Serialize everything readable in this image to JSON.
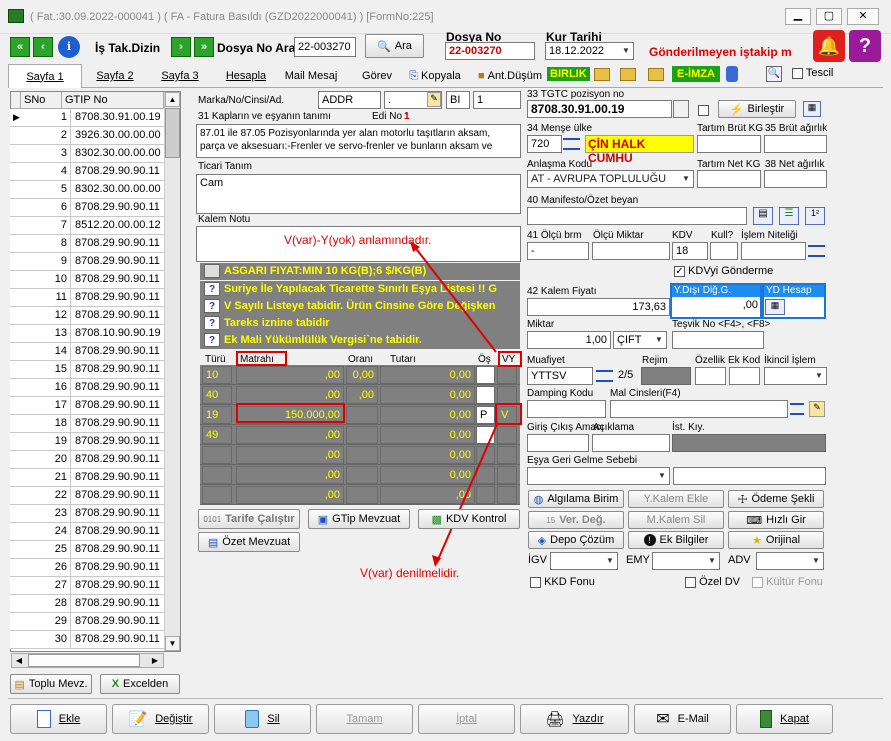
{
  "window": {
    "title": "( Fat.:30.09.2022-000041 ) ( FA  - Fatura Basıldı (GZD2022000041) ) [FormNo:225]"
  },
  "toolbar": {
    "is_takip": "İş Tak.Dizin",
    "dosya_no_ara": "Dosya No Ara",
    "dosya_no_value": "22-003270",
    "ara": "Ara",
    "dosya_no_label": "Dosya No",
    "dosya_no_red": "22-003270",
    "kur_tarihi_label": "Kur Tarihi",
    "kur_tarihi": "18.12.2022",
    "gonderilmeyen": "Gönderilmeyen iştakip m"
  },
  "tabs": [
    "Sayfa 1",
    "Sayfa 2",
    "Sayfa 3",
    "Hesapla",
    "Mail Mesaj",
    "Görev",
    "Kopyala",
    "Ant.Düşüm"
  ],
  "tab_extras": {
    "birlik": "BIRLIK",
    "eimza": "E-İMZA",
    "tescil": "Tescil"
  },
  "grid": {
    "col_sno": "SNo",
    "col_gtip": "GTIP No",
    "rows": [
      [
        "1",
        "8708.30.91.00.19"
      ],
      [
        "2",
        "3926.30.00.00.00"
      ],
      [
        "3",
        "8302.30.00.00.00"
      ],
      [
        "4",
        "8708.29.90.90.11"
      ],
      [
        "5",
        "8302.30.00.00.00"
      ],
      [
        "6",
        "8708.29.90.90.11"
      ],
      [
        "7",
        "8512.20.00.00.12"
      ],
      [
        "8",
        "8708.29.90.90.11"
      ],
      [
        "9",
        "8708.29.90.90.11"
      ],
      [
        "10",
        "8708.29.90.90.11"
      ],
      [
        "11",
        "8708.29.90.90.11"
      ],
      [
        "12",
        "8708.29.90.90.11"
      ],
      [
        "13",
        "8708.10.90.90.19"
      ],
      [
        "14",
        "8708.29.90.90.11"
      ],
      [
        "15",
        "8708.29.90.90.11"
      ],
      [
        "16",
        "8708.29.90.90.11"
      ],
      [
        "17",
        "8708.29.90.90.11"
      ],
      [
        "18",
        "8708.29.90.90.11"
      ],
      [
        "19",
        "8708.29.90.90.11"
      ],
      [
        "20",
        "8708.29.90.90.11"
      ],
      [
        "21",
        "8708.29.90.90.11"
      ],
      [
        "22",
        "8708.29.90.90.11"
      ],
      [
        "23",
        "8708.29.90.90.11"
      ],
      [
        "24",
        "8708.29.90.90.11"
      ],
      [
        "25",
        "8708.29.90.90.11"
      ],
      [
        "26",
        "8708.29.90.90.11"
      ],
      [
        "27",
        "8708.29.90.90.11"
      ],
      [
        "28",
        "8708.29.90.90.11"
      ],
      [
        "29",
        "8708.29.90.90.11"
      ],
      [
        "30",
        "8708.29.90.90.11"
      ]
    ]
  },
  "left_buttons": {
    "toplu": "Toplu Mevz.",
    "excel": "Excelden"
  },
  "form": {
    "marka_label": "Marka/No/Cinsi/Ad.",
    "marka_val": "ADDR",
    "marka_val2": ".",
    "marka_val3": "BI",
    "marka_val4": "1",
    "kap_label": "31 Kapların ve eşyanın tanımı",
    "edi_label": "Edi No :",
    "edi_val": "1",
    "tanim": "87.01 ile 87.05 Pozisyonlarında yer alan motorlu taşıtların aksam, parça ve aksesuarı:-Frenler ve servo-frenler ve bunların aksam ve",
    "ticari_label": "Ticari Tanım",
    "ticari_val": "Cam",
    "kalem_notu_label": "Kalem Notu",
    "annotation1": "V(var)-Y(yok) anlamındadır.",
    "annotation2": "V(var) denilmelidir."
  },
  "warnings": {
    "asgari": "ASGARI FIYAT:MIN 10 KG(B);6 $/KG(B)",
    "w1": "Suriye İle Yapılacak Ticarette Sınırlı Eşya Listesi !! G",
    "w2": "V Sayılı Listeye tabidir. Ürün Cinsine Göre Değişken",
    "w3": "Tareks iznine tabidir",
    "w4": "Ek Mali Yükümlülük Vergisi`ne tabidir."
  },
  "tax": {
    "h_turu": "Türü",
    "h_matrahi": "Matrahı",
    "h_orani": "Oranı",
    "h_tutari": "Tutarı",
    "h_os": "Öş",
    "h_vy": "VY",
    "rows": [
      {
        "turu": "10",
        "matrah": ",00",
        "oran": "0,00",
        "tutar": "0,00",
        "os": "",
        "vy": ""
      },
      {
        "turu": "40",
        "matrah": ",00",
        "oran": ",00",
        "tutar": "0,00",
        "os": "",
        "vy": ""
      },
      {
        "turu": "19",
        "matrah": "150.000,00",
        "oran": "",
        "tutar": "0,00",
        "os": "P",
        "vy": "V"
      },
      {
        "turu": "49",
        "matrah": ",00",
        "oran": "",
        "tutar": "0,00",
        "os": "",
        "vy": ""
      },
      {
        "turu": "",
        "matrah": ",00",
        "oran": "",
        "tutar": "0,00",
        "os": "",
        "vy": ""
      },
      {
        "turu": "",
        "matrah": ",00",
        "oran": "",
        "tutar": "0,00",
        "os": "",
        "vy": ""
      },
      {
        "turu": "",
        "matrah": ",00",
        "oran": "",
        "tutar": ",00",
        "os": "",
        "vy": ""
      }
    ]
  },
  "mid_buttons": {
    "tarife": "Tarife Çalıştır",
    "gtip": "GTip Mevzuat",
    "kdv": "KDV Kontrol",
    "ozet": "Özet Mevzuat"
  },
  "right": {
    "tgtc_label": "33 TGTC pozisyon no",
    "tgtc_val": "8708.30.91.00.19",
    "birlestir": "Birleştir",
    "mense_label": "34 Menşe ülke",
    "mense_code": "720",
    "mense_name": "ÇİN HALK CUMHU",
    "tartim_brut_label": "Tartım Brüt KG",
    "brut_label": "35 Brüt ağırlık",
    "anlasma_label": "Anlaşma Kodu",
    "anlasma_val": "AT    - AVRUPA TOPLULUĞU",
    "tartim_net_label": "Tartım Net KG",
    "net_label": "38 Net ağırlık",
    "manifesto_label": "40 Manifesto/Özet beyan",
    "olcu_label": "41 Ölçü brm",
    "olcu_miktar_label": "Ölçü Miktar",
    "kdv_label": "KDV",
    "kdv_val": "18",
    "kull_label": "Kull?",
    "islem_label": "İşlem Niteliği",
    "olcu_val": "-",
    "kdv_gonderme": "KDVyi Gönderme",
    "kalem_fiyat_label": "42 Kalem Fiyatı",
    "kalem_fiyat_val": "173,63",
    "ydisi_label": "Y.Dışı Diğ.G.",
    "ydisi_val": ",00",
    "yd_hesap": "YD Hesap",
    "miktar_label": "Miktar",
    "miktar_val": "1,00",
    "miktar_unit": "ÇIFT",
    "tesvik_label": "Teşvik No <F4>, <F8>",
    "muafiyet_label": "Muafiyet",
    "muafiyet_val": "YTTSV",
    "rejim_label": "Rejim",
    "rejim_val": "2/5",
    "ozellik_label": "Özellik",
    "ek_kod_label": "Ek Kod",
    "ikincil_label": "İkincil İşlem",
    "damping_label": "Damping Kodu",
    "mal_cinsleri_label": "Mal Cinsleri(F4)",
    "giris_label": "Giriş Çıkış Amacı",
    "aciklama_label": "Açıklama",
    "ist_kiy_label": "İst. Kıy.",
    "esya_geri_label": "Eşya Geri Gelme Sebebi",
    "b_alg": "Algılama Birim",
    "b_ykalem": "Y.Kalem Ekle",
    "b_odeme": "Ödeme Şekli",
    "b_verdeg": "Ver. Değ.",
    "b_mkalem": "M.Kalem Sil",
    "b_hizli": "Hızlı Gir",
    "b_depo": "Depo Çözüm",
    "b_ek": "Ek Bilgiler",
    "b_orijinal": "Orijinal",
    "igv_label": "İGV",
    "emy_label": "EMY",
    "adv_label": "ADV",
    "kkd": "KKD Fonu",
    "ozel_dv": "Özel DV",
    "kultur": "Kültür Fonu"
  },
  "bottom": [
    "Ekle",
    "Değiştir",
    "Sil",
    "Tamam",
    "İptal",
    "Yazdır",
    "E-Mail",
    "Kapat"
  ]
}
